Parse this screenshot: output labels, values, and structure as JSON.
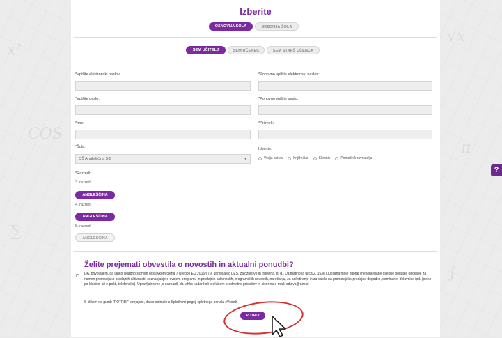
{
  "header": {
    "title": "Izberite"
  },
  "school_type": {
    "primary": "OSNOVNA ŠOLA",
    "secondary": "SREDNJA ŠOLA"
  },
  "role": {
    "teacher": "SEM UČITELJ",
    "student": "SEM UČENEC",
    "parent": "SEM STARŠ UČENCA"
  },
  "form": {
    "email_label": "*Vpišite elektronski naslov:",
    "email_confirm_label": "*Ponovno vpišite elektronski naslov:",
    "password_label": "*Vpišite geslo:",
    "password_confirm_label": "*Ponovno vpišite geslo:",
    "first_name_label": "*Ime:",
    "last_name_label": "*Priimek:",
    "school_label": "*Šola:",
    "school_value": "OŠ Anglešičina 3-5",
    "choose_label": "Izberite:",
    "choose_options": [
      "Vodja aktiva",
      "Knjižničar",
      "Skrbnik",
      "Pomočnik ravnatelja"
    ],
    "grades_label": "*Razredi:",
    "grades": [
      {
        "label": "3. razred",
        "button": "ANGLEŠČINA"
      },
      {
        "label": "4. razred",
        "button": "ANGLEŠČINA"
      },
      {
        "label": "5. razred",
        "button": "ANGLEŠČINA"
      }
    ]
  },
  "newsletter": {
    "title": "Želite prejemati obvestila o novostih in aktualni ponudbi?",
    "consent_text": "DA, privoljujem, da lahko skladno s prvim odstavkom člena 7 Uredbe EU 2016/679, upravljalec DZS, založništvo in trgovina, d. d., Dalmatinova ulica 2, 1538 Ljubljana moje zgoraj vnešene/dane osebne podatke obdeluje za namen promocijsko prodajnih aktivnosti: seznanjanje o svojem programu in prodajnih aktivnostih, programskih novostih, naročanju, za anketiranje in za vabila na promocijsko-prodajne dogodke, seminarje, delavnice ipd. (pisno po klasični ali e-pošti, telefonsko). Upravljalec me je seznanil, da lahko kadar koli prekličem predmetno privolitev in sicer na e-mail: odjava@dzs.si",
    "terms_text": "S klikom na gumb \"POTRDI\" potrjujete, da se strinjate s Splošnimi pogoji spletnega portala eVedež.",
    "submit_label": "POTRDI"
  },
  "help": {
    "label": "?"
  },
  "colors": {
    "accent": "#7b2aa0",
    "highlight": "#d83030"
  }
}
